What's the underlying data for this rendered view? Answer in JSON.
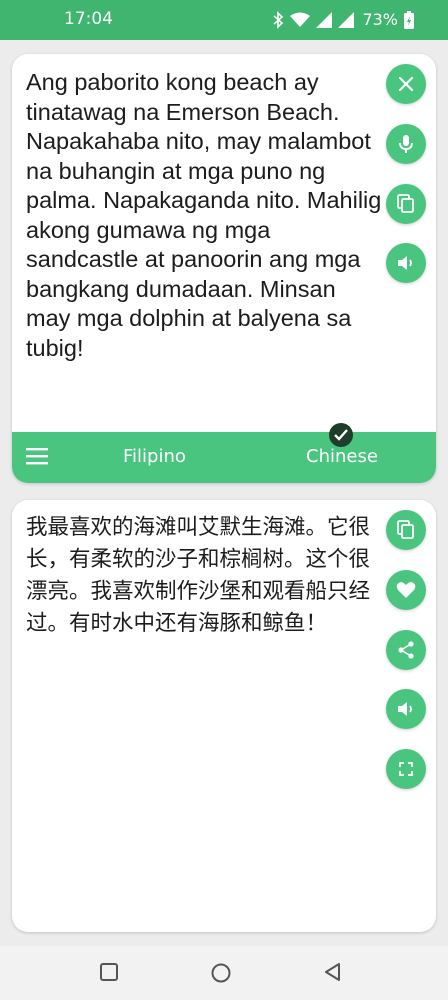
{
  "status_bar": {
    "time": "17:04",
    "battery": "73%",
    "icons": [
      "bluetooth-icon",
      "wifi-icon",
      "signal-icon",
      "signal-icon",
      "battery-icon"
    ]
  },
  "source": {
    "text": "Ang paborito kong beach ay tinatawag na Emerson Beach. Napakahaba nito, may malambot na buhangin at mga puno ng palma. Napakaganda nito. Mahilig akong gumawa ng mga sandcastle at panoorin ang mga bangkang dumadaan. Minsan may mga dolphin at balyena sa tubig!",
    "actions": [
      "close-icon",
      "mic-icon",
      "copy-icon",
      "speaker-icon"
    ]
  },
  "language_bar": {
    "source_language": "Filipino",
    "target_language": "Chinese",
    "selected": "Chinese"
  },
  "target": {
    "text": "我最喜欢的海滩叫艾默生海滩。它很长，有柔软的沙子和棕榈树。这个很漂亮。我喜欢制作沙堡和观看船只经过。有时水中还有海豚和鲸鱼！",
    "actions": [
      "copy-icon",
      "heart-icon",
      "share-icon",
      "speaker-icon",
      "fullscreen-icon"
    ]
  },
  "colors": {
    "accent": "#4ac57f",
    "status_bar": "#3fb570",
    "check_badge": "#1f3d2b",
    "background": "#ececec"
  }
}
